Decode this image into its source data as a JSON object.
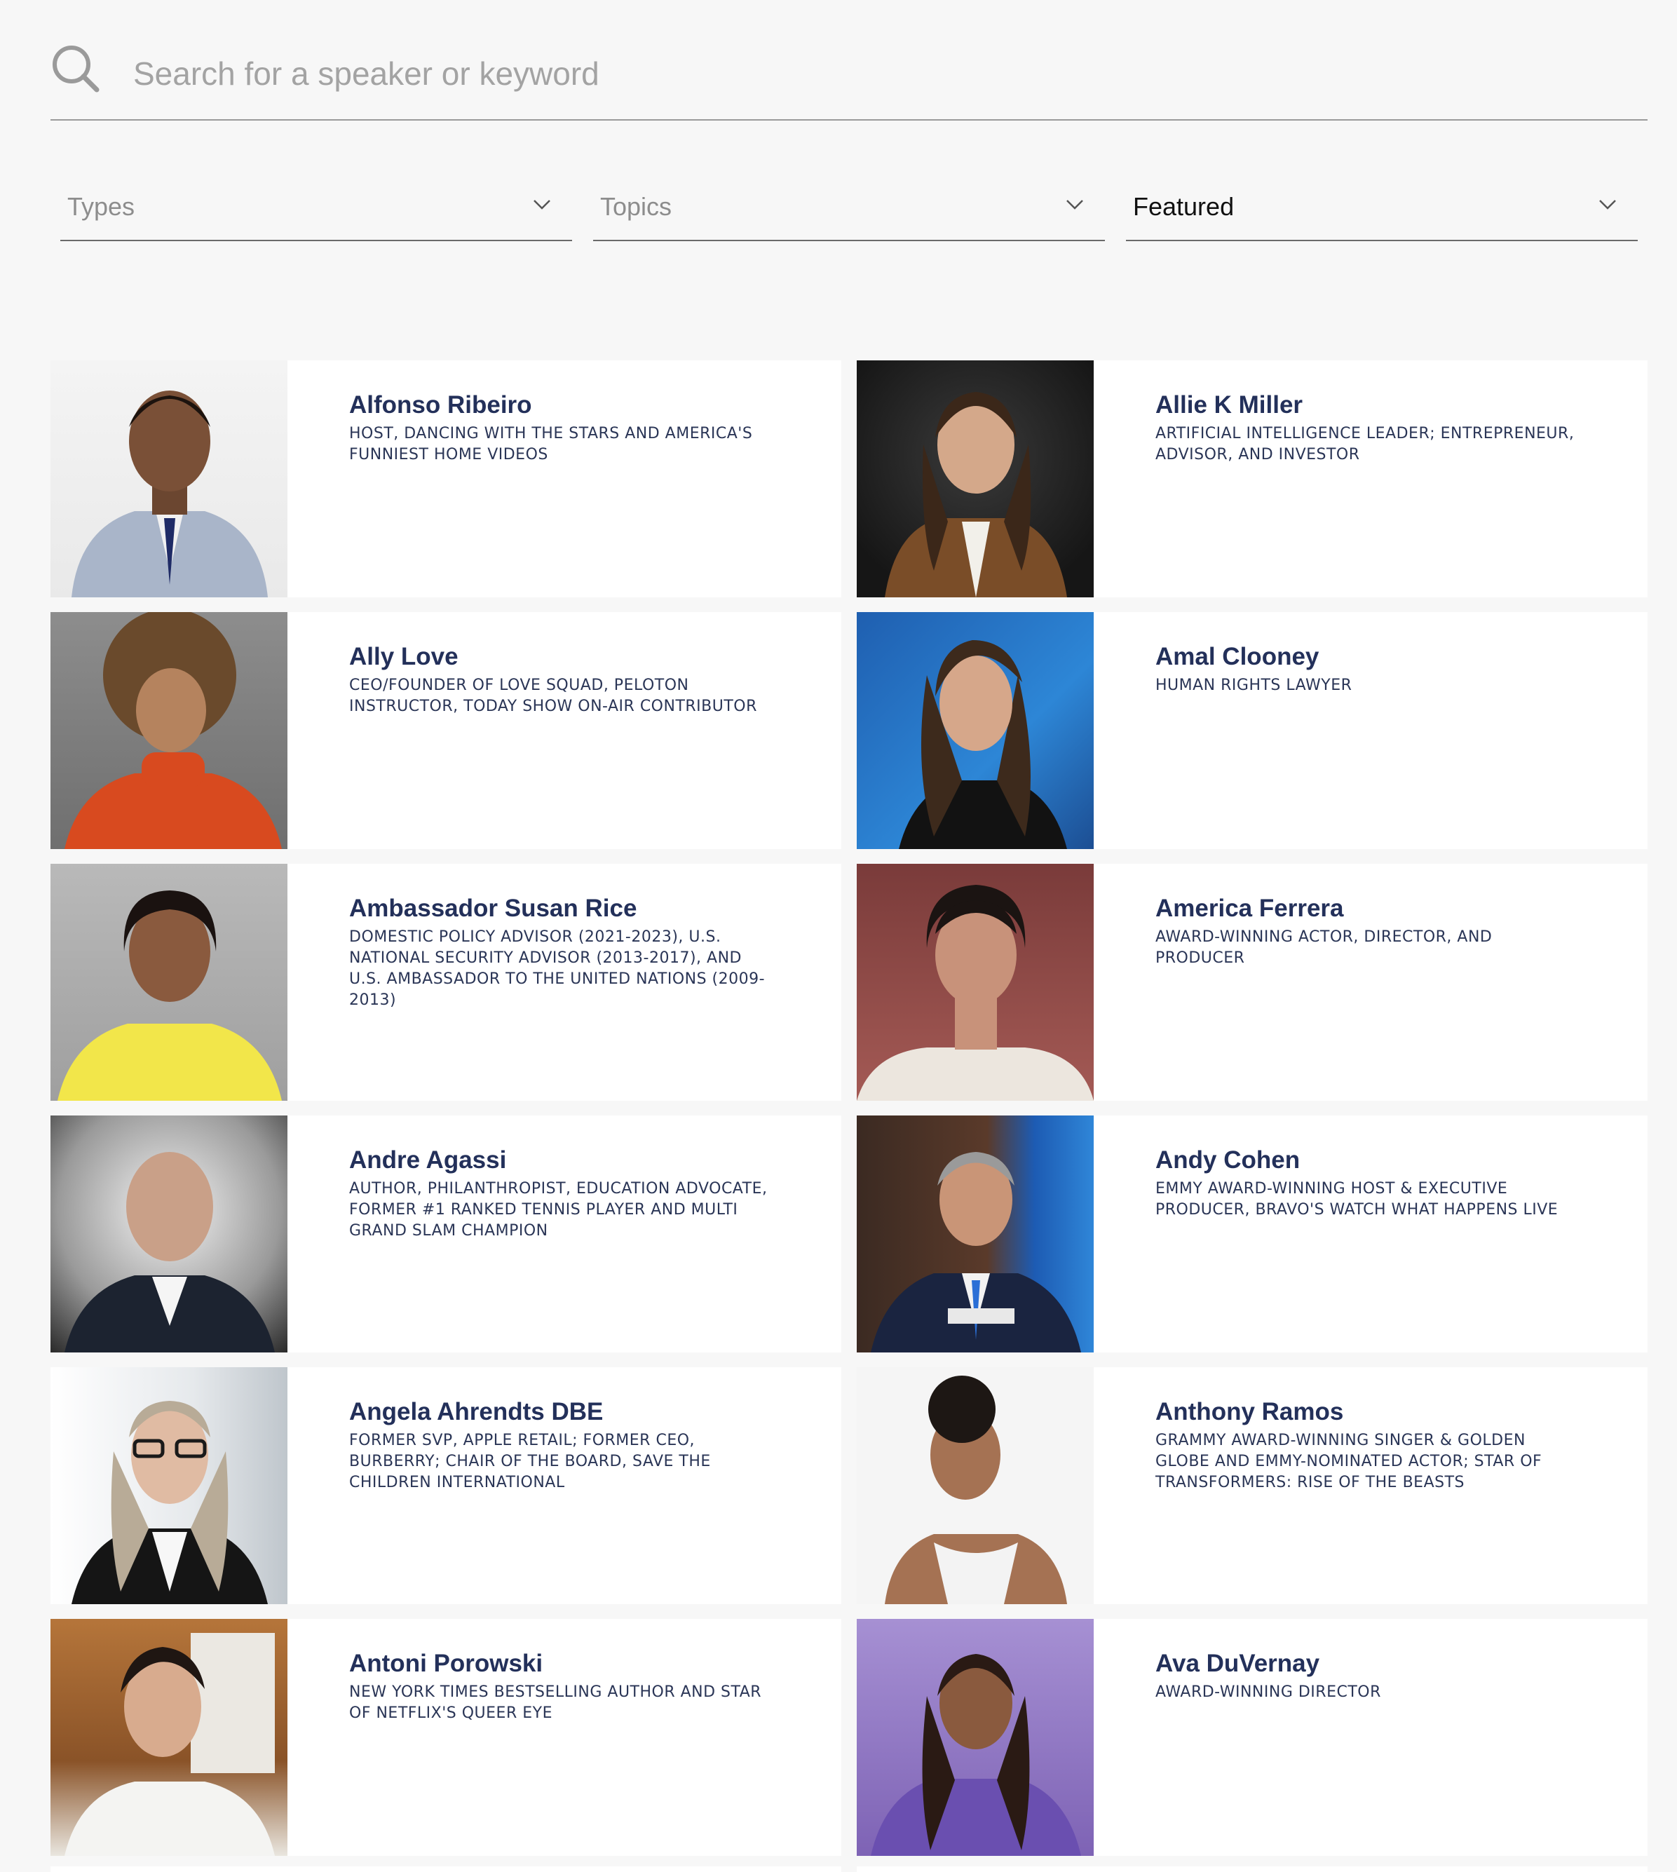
{
  "search": {
    "placeholder": "Search for a speaker or keyword",
    "value": ""
  },
  "filters": [
    {
      "label": "Types",
      "selected": false
    },
    {
      "label": "Topics",
      "selected": false
    },
    {
      "label": "Featured",
      "selected": true
    }
  ],
  "speakers": [
    {
      "name": "Alfonso Ribeiro",
      "title": "HOST, DANCING WITH THE STARS AND AMERICA'S FUNNIEST HOME VIDEOS"
    },
    {
      "name": "Allie K Miller",
      "title": "ARTIFICIAL INTELLIGENCE LEADER; ENTREPRENEUR, ADVISOR, AND INVESTOR"
    },
    {
      "name": "Ally Love",
      "title": "CEO/FOUNDER OF LOVE SQUAD, PELOTON INSTRUCTOR, TODAY SHOW ON-AIR CONTRIBUTOR"
    },
    {
      "name": "Amal Clooney",
      "title": "HUMAN RIGHTS LAWYER"
    },
    {
      "name": "Ambassador Susan Rice",
      "title": "DOMESTIC POLICY ADVISOR (2021-2023), U.S. NATIONAL SECURITY ADVISOR (2013-2017), AND U.S. AMBASSADOR TO THE UNITED NATIONS (2009-2013)"
    },
    {
      "name": "America Ferrera",
      "title": "AWARD-WINNING ACTOR, DIRECTOR, AND PRODUCER"
    },
    {
      "name": "Andre Agassi",
      "title": "AUTHOR, PHILANTHROPIST, EDUCATION ADVOCATE, FORMER #1 RANKED TENNIS PLAYER AND MULTI GRAND SLAM CHAMPION"
    },
    {
      "name": "Andy Cohen",
      "title": "EMMY AWARD-WINNING HOST & EXECUTIVE PRODUCER, BRAVO'S WATCH WHAT HAPPENS LIVE"
    },
    {
      "name": "Angela Ahrendts DBE",
      "title": "FORMER SVP, APPLE RETAIL; FORMER CEO, BURBERRY; CHAIR OF THE BOARD, SAVE THE CHILDREN INTERNATIONAL"
    },
    {
      "name": "Anthony Ramos",
      "title": "GRAMMY AWARD-WINNING SINGER & GOLDEN GLOBE AND EMMY-NOMINATED ACTOR; STAR OF TRANSFORMERS: RISE OF THE BEASTS"
    },
    {
      "name": "Antoni Porowski",
      "title": "NEW YORK TIMES BESTSELLING AUTHOR AND STAR OF NETFLIX'S QUEER EYE"
    },
    {
      "name": "Ava DuVernay",
      "title": "AWARD-WINNING DIRECTOR"
    }
  ]
}
